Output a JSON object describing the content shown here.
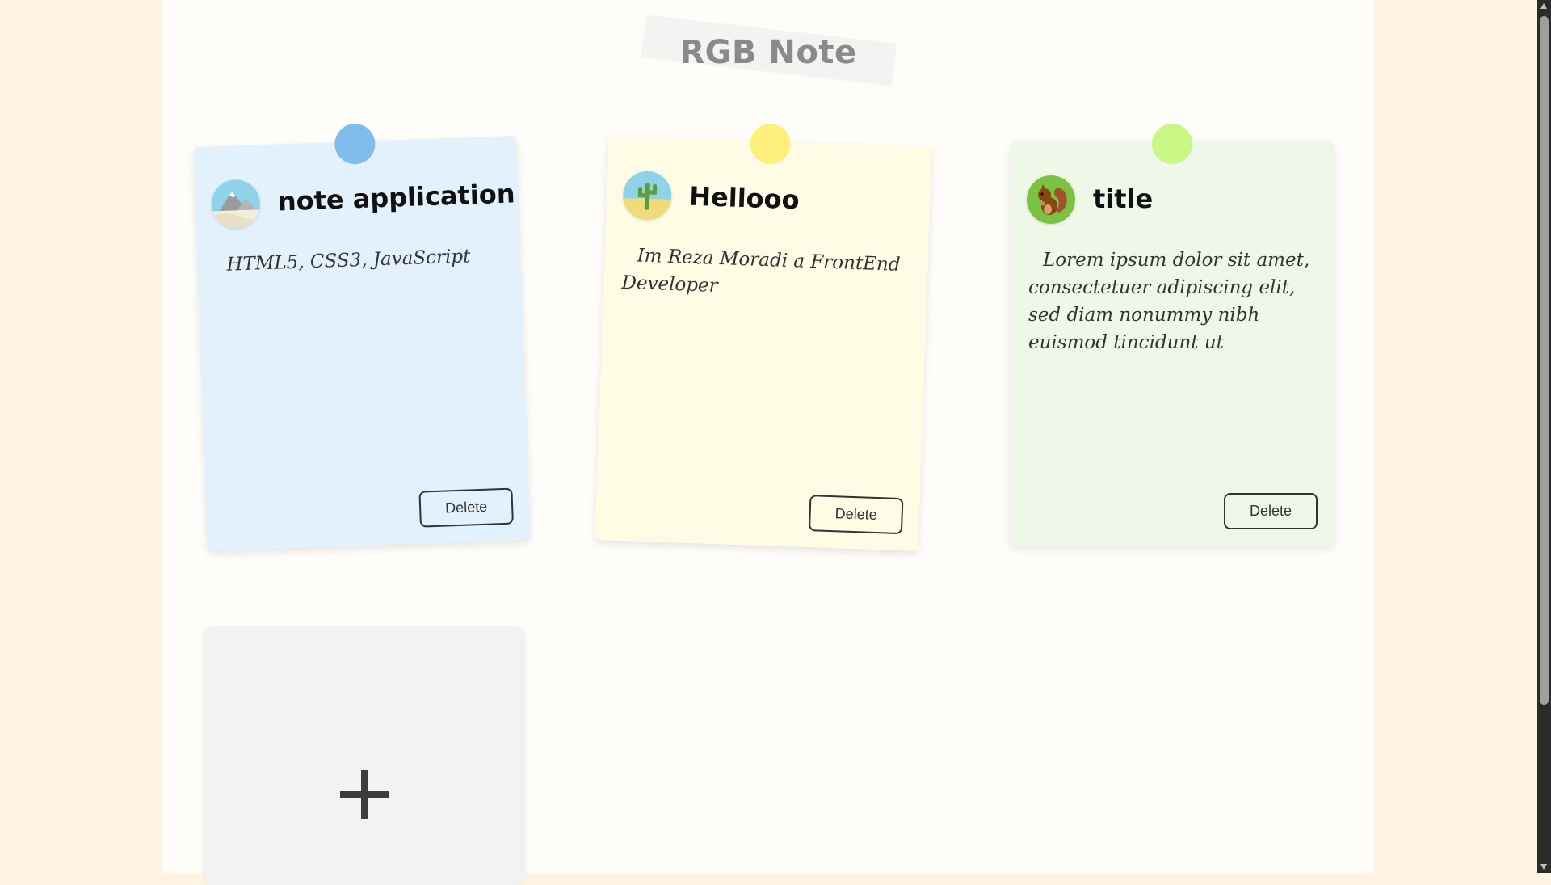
{
  "header": {
    "title": "RGB Note"
  },
  "notes": [
    {
      "title": "note application",
      "body": "HTML5, CSS3, JavaScript",
      "delete_label": "Delete",
      "pin_color": "#7fbdea",
      "bg_color": "#e3f1fd",
      "avatar_icon": "mountain-landscape-icon"
    },
    {
      "title": "Hellooo",
      "body": "Im Reza Moradi a FrontEnd Developer",
      "delete_label": "Delete",
      "pin_color": "#fff07d",
      "bg_color": "#fffce5",
      "avatar_icon": "cactus-desert-icon"
    },
    {
      "title": "title",
      "body": "Lorem ipsum dolor sit amet, consectetuer adipiscing elit, sed diam nonummy nibh euismod tincidunt ut",
      "delete_label": "Delete",
      "pin_color": "#c8f785",
      "bg_color": "#eff7e9",
      "avatar_icon": "squirrel-icon"
    }
  ],
  "add_note": {
    "icon": "plus-icon"
  }
}
